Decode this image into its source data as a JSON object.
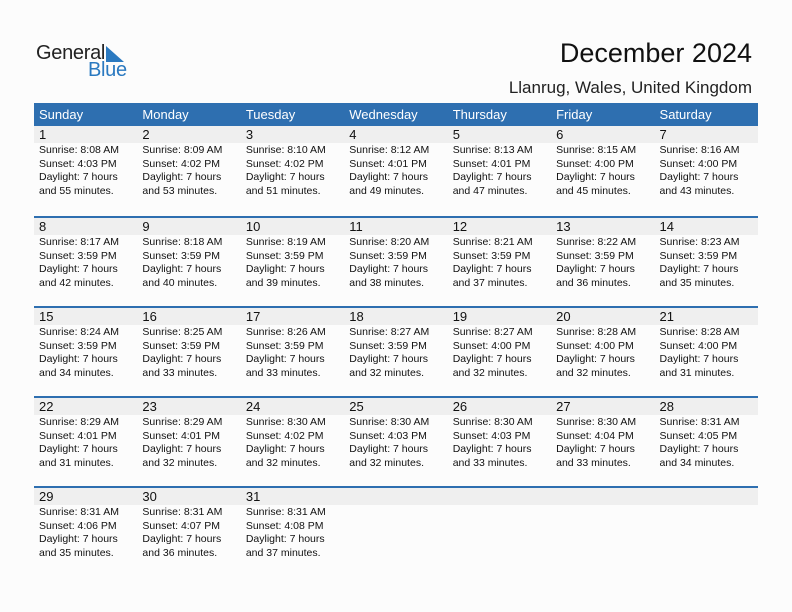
{
  "logo": {
    "general": "General",
    "blue": "Blue",
    "icon": "triangle-flag-icon",
    "accent": "#2a79c0"
  },
  "header": {
    "title": "December 2024",
    "location": "Llanrug, Wales, United Kingdom"
  },
  "colors": {
    "header_bg": "#2e6fb0",
    "day_row_bg": "#efefef"
  },
  "weekdays": [
    "Sunday",
    "Monday",
    "Tuesday",
    "Wednesday",
    "Thursday",
    "Friday",
    "Saturday"
  ],
  "weeks": [
    [
      {
        "day": "1",
        "sunrise": "Sunrise: 8:08 AM",
        "sunset": "Sunset: 4:03 PM",
        "daylight1": "Daylight: 7 hours",
        "daylight2": "and 55 minutes."
      },
      {
        "day": "2",
        "sunrise": "Sunrise: 8:09 AM",
        "sunset": "Sunset: 4:02 PM",
        "daylight1": "Daylight: 7 hours",
        "daylight2": "and 53 minutes."
      },
      {
        "day": "3",
        "sunrise": "Sunrise: 8:10 AM",
        "sunset": "Sunset: 4:02 PM",
        "daylight1": "Daylight: 7 hours",
        "daylight2": "and 51 minutes."
      },
      {
        "day": "4",
        "sunrise": "Sunrise: 8:12 AM",
        "sunset": "Sunset: 4:01 PM",
        "daylight1": "Daylight: 7 hours",
        "daylight2": "and 49 minutes."
      },
      {
        "day": "5",
        "sunrise": "Sunrise: 8:13 AM",
        "sunset": "Sunset: 4:01 PM",
        "daylight1": "Daylight: 7 hours",
        "daylight2": "and 47 minutes."
      },
      {
        "day": "6",
        "sunrise": "Sunrise: 8:15 AM",
        "sunset": "Sunset: 4:00 PM",
        "daylight1": "Daylight: 7 hours",
        "daylight2": "and 45 minutes."
      },
      {
        "day": "7",
        "sunrise": "Sunrise: 8:16 AM",
        "sunset": "Sunset: 4:00 PM",
        "daylight1": "Daylight: 7 hours",
        "daylight2": "and 43 minutes."
      }
    ],
    [
      {
        "day": "8",
        "sunrise": "Sunrise: 8:17 AM",
        "sunset": "Sunset: 3:59 PM",
        "daylight1": "Daylight: 7 hours",
        "daylight2": "and 42 minutes."
      },
      {
        "day": "9",
        "sunrise": "Sunrise: 8:18 AM",
        "sunset": "Sunset: 3:59 PM",
        "daylight1": "Daylight: 7 hours",
        "daylight2": "and 40 minutes."
      },
      {
        "day": "10",
        "sunrise": "Sunrise: 8:19 AM",
        "sunset": "Sunset: 3:59 PM",
        "daylight1": "Daylight: 7 hours",
        "daylight2": "and 39 minutes."
      },
      {
        "day": "11",
        "sunrise": "Sunrise: 8:20 AM",
        "sunset": "Sunset: 3:59 PM",
        "daylight1": "Daylight: 7 hours",
        "daylight2": "and 38 minutes."
      },
      {
        "day": "12",
        "sunrise": "Sunrise: 8:21 AM",
        "sunset": "Sunset: 3:59 PM",
        "daylight1": "Daylight: 7 hours",
        "daylight2": "and 37 minutes."
      },
      {
        "day": "13",
        "sunrise": "Sunrise: 8:22 AM",
        "sunset": "Sunset: 3:59 PM",
        "daylight1": "Daylight: 7 hours",
        "daylight2": "and 36 minutes."
      },
      {
        "day": "14",
        "sunrise": "Sunrise: 8:23 AM",
        "sunset": "Sunset: 3:59 PM",
        "daylight1": "Daylight: 7 hours",
        "daylight2": "and 35 minutes."
      }
    ],
    [
      {
        "day": "15",
        "sunrise": "Sunrise: 8:24 AM",
        "sunset": "Sunset: 3:59 PM",
        "daylight1": "Daylight: 7 hours",
        "daylight2": "and 34 minutes."
      },
      {
        "day": "16",
        "sunrise": "Sunrise: 8:25 AM",
        "sunset": "Sunset: 3:59 PM",
        "daylight1": "Daylight: 7 hours",
        "daylight2": "and 33 minutes."
      },
      {
        "day": "17",
        "sunrise": "Sunrise: 8:26 AM",
        "sunset": "Sunset: 3:59 PM",
        "daylight1": "Daylight: 7 hours",
        "daylight2": "and 33 minutes."
      },
      {
        "day": "18",
        "sunrise": "Sunrise: 8:27 AM",
        "sunset": "Sunset: 3:59 PM",
        "daylight1": "Daylight: 7 hours",
        "daylight2": "and 32 minutes."
      },
      {
        "day": "19",
        "sunrise": "Sunrise: 8:27 AM",
        "sunset": "Sunset: 4:00 PM",
        "daylight1": "Daylight: 7 hours",
        "daylight2": "and 32 minutes."
      },
      {
        "day": "20",
        "sunrise": "Sunrise: 8:28 AM",
        "sunset": "Sunset: 4:00 PM",
        "daylight1": "Daylight: 7 hours",
        "daylight2": "and 32 minutes."
      },
      {
        "day": "21",
        "sunrise": "Sunrise: 8:28 AM",
        "sunset": "Sunset: 4:00 PM",
        "daylight1": "Daylight: 7 hours",
        "daylight2": "and 31 minutes."
      }
    ],
    [
      {
        "day": "22",
        "sunrise": "Sunrise: 8:29 AM",
        "sunset": "Sunset: 4:01 PM",
        "daylight1": "Daylight: 7 hours",
        "daylight2": "and 31 minutes."
      },
      {
        "day": "23",
        "sunrise": "Sunrise: 8:29 AM",
        "sunset": "Sunset: 4:01 PM",
        "daylight1": "Daylight: 7 hours",
        "daylight2": "and 32 minutes."
      },
      {
        "day": "24",
        "sunrise": "Sunrise: 8:30 AM",
        "sunset": "Sunset: 4:02 PM",
        "daylight1": "Daylight: 7 hours",
        "daylight2": "and 32 minutes."
      },
      {
        "day": "25",
        "sunrise": "Sunrise: 8:30 AM",
        "sunset": "Sunset: 4:03 PM",
        "daylight1": "Daylight: 7 hours",
        "daylight2": "and 32 minutes."
      },
      {
        "day": "26",
        "sunrise": "Sunrise: 8:30 AM",
        "sunset": "Sunset: 4:03 PM",
        "daylight1": "Daylight: 7 hours",
        "daylight2": "and 33 minutes."
      },
      {
        "day": "27",
        "sunrise": "Sunrise: 8:30 AM",
        "sunset": "Sunset: 4:04 PM",
        "daylight1": "Daylight: 7 hours",
        "daylight2": "and 33 minutes."
      },
      {
        "day": "28",
        "sunrise": "Sunrise: 8:31 AM",
        "sunset": "Sunset: 4:05 PM",
        "daylight1": "Daylight: 7 hours",
        "daylight2": "and 34 minutes."
      }
    ],
    [
      {
        "day": "29",
        "sunrise": "Sunrise: 8:31 AM",
        "sunset": "Sunset: 4:06 PM",
        "daylight1": "Daylight: 7 hours",
        "daylight2": "and 35 minutes."
      },
      {
        "day": "30",
        "sunrise": "Sunrise: 8:31 AM",
        "sunset": "Sunset: 4:07 PM",
        "daylight1": "Daylight: 7 hours",
        "daylight2": "and 36 minutes."
      },
      {
        "day": "31",
        "sunrise": "Sunrise: 8:31 AM",
        "sunset": "Sunset: 4:08 PM",
        "daylight1": "Daylight: 7 hours",
        "daylight2": "and 37 minutes."
      },
      {},
      {},
      {},
      {}
    ]
  ]
}
